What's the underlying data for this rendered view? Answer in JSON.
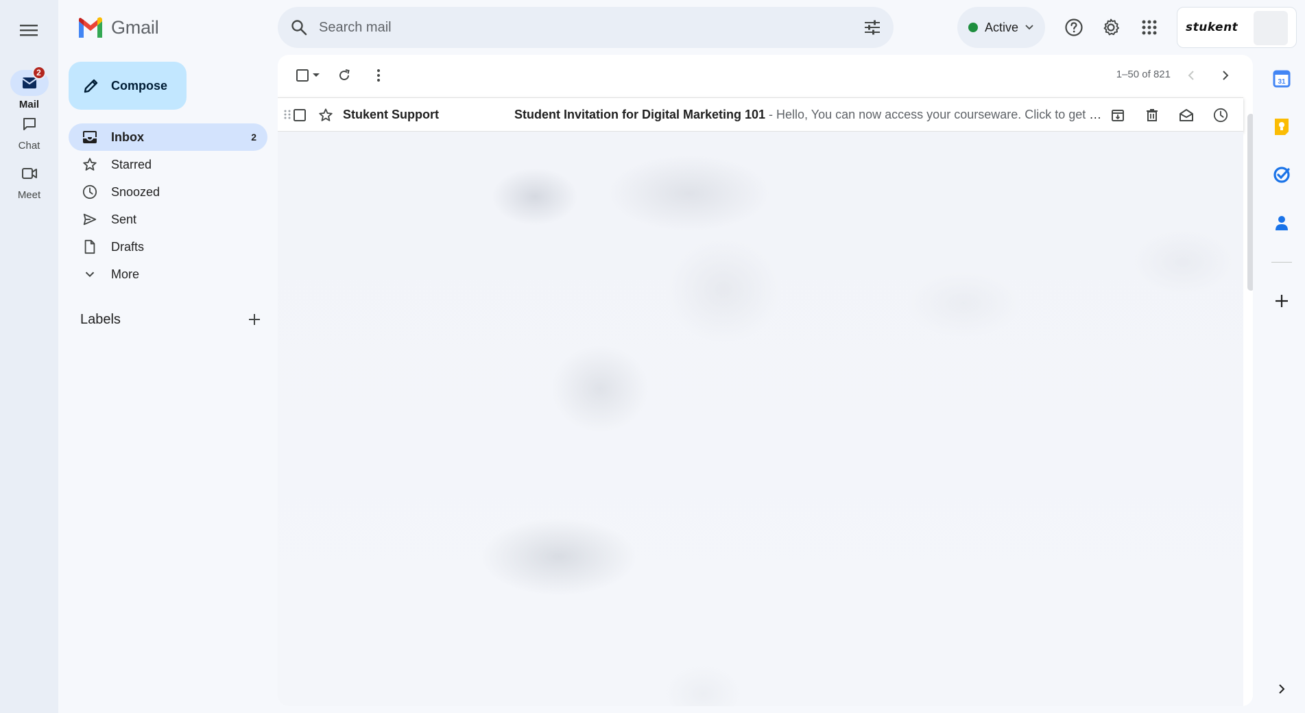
{
  "app": {
    "name": "Gmail"
  },
  "rail": {
    "items": [
      {
        "label": "Mail",
        "badge": "2"
      },
      {
        "label": "Chat"
      },
      {
        "label": "Meet"
      }
    ]
  },
  "search": {
    "placeholder": "Search mail"
  },
  "status": {
    "label": "Active",
    "color": "#1e8e3e"
  },
  "account": {
    "org_logo": "stukent"
  },
  "compose": {
    "label": "Compose"
  },
  "nav": {
    "items": [
      {
        "label": "Inbox",
        "count": "2"
      },
      {
        "label": "Starred"
      },
      {
        "label": "Snoozed"
      },
      {
        "label": "Sent"
      },
      {
        "label": "Drafts"
      },
      {
        "label": "More"
      }
    ]
  },
  "labels": {
    "title": "Labels"
  },
  "toolbar": {
    "pager": "1–50 of 821"
  },
  "emails": [
    {
      "sender": "Stukent Support",
      "subject": "Student Invitation for Digital Marketing 101",
      "snippet": " - Hello, You can now access your courseware. Click to get started: Invitation Link"
    }
  ],
  "colors": {
    "accent": "#0b57d0",
    "compose_bg": "#c2e7ff",
    "active_nav": "#d3e3fd"
  }
}
